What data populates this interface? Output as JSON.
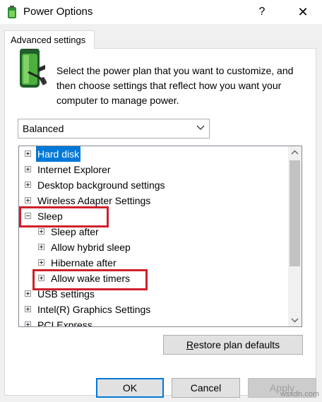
{
  "window": {
    "title": "Power Options",
    "help_glyph": "?",
    "close_glyph": "✕"
  },
  "tab": {
    "label": "Advanced settings"
  },
  "description": "Select the power plan that you want to customize, and then choose settings that reflect how you want your computer to manage power.",
  "plan_select": {
    "value": "Balanced"
  },
  "tree": {
    "items": [
      {
        "label": "Hard disk",
        "expander": "plus",
        "selected": true
      },
      {
        "label": "Internet Explorer",
        "expander": "plus"
      },
      {
        "label": "Desktop background settings",
        "expander": "plus"
      },
      {
        "label": "Wireless Adapter Settings",
        "expander": "plus"
      },
      {
        "label": "Sleep",
        "expander": "minus"
      },
      {
        "label": "Sleep after",
        "expander": "plus"
      },
      {
        "label": "Allow hybrid sleep",
        "expander": "plus"
      },
      {
        "label": "Hibernate after",
        "expander": "plus"
      },
      {
        "label": "Allow wake timers",
        "expander": "plus"
      },
      {
        "label": "USB settings",
        "expander": "plus"
      },
      {
        "label": "Intel(R) Graphics Settings",
        "expander": "plus"
      },
      {
        "label": "PCI Express",
        "expander": "plus"
      }
    ]
  },
  "buttons": {
    "restore_prefix": "R",
    "restore_rest": "estore plan defaults",
    "ok": "OK",
    "cancel": "Cancel",
    "apply": "Apply"
  },
  "watermark": "wsxdn.com",
  "colors": {
    "accent": "#0078d7",
    "highlight": "#d0202a"
  }
}
